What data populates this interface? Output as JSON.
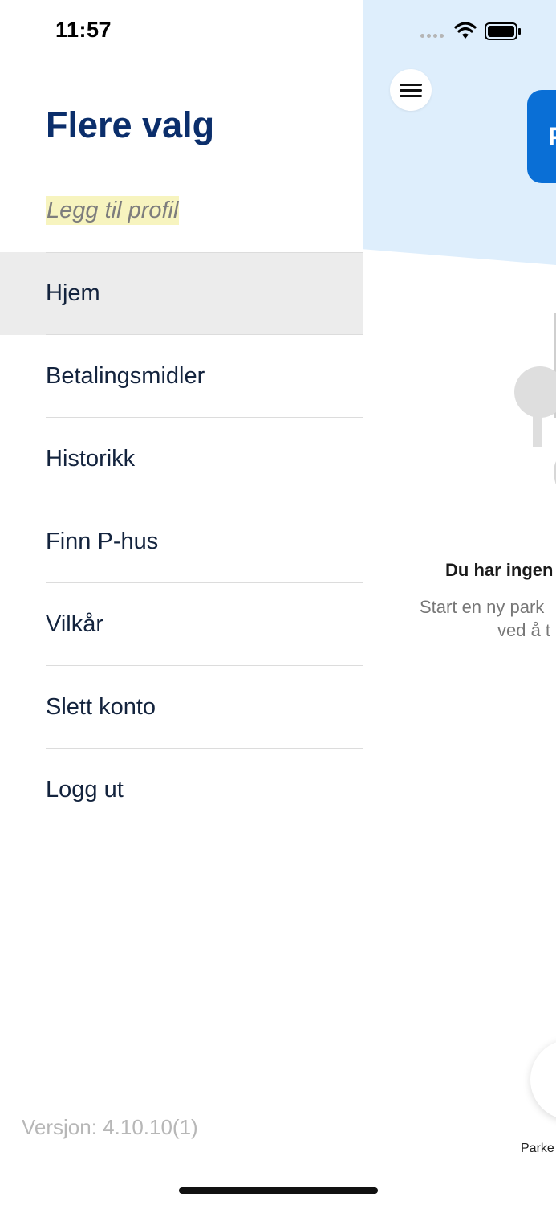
{
  "status_bar": {
    "time": "11:57",
    "icons": [
      "signal-icon",
      "wifi-icon",
      "battery-icon"
    ]
  },
  "drawer": {
    "title": "Flere valg",
    "add_profile": "Legg til profil",
    "menu_items": [
      {
        "label": "Hjem",
        "active": true
      },
      {
        "label": "Betalingsmidler",
        "active": false
      },
      {
        "label": "Historikk",
        "active": false
      },
      {
        "label": "Finn P-hus",
        "active": false
      },
      {
        "label": "Vilkår",
        "active": false
      },
      {
        "label": "Slett konto",
        "active": false
      },
      {
        "label": "Logg ut",
        "active": false
      }
    ],
    "version": "Versjon: 4.10.10(1)"
  },
  "main": {
    "menu_icon": "hamburger-icon",
    "card_text": "P",
    "empty_title": "Du har ingen",
    "empty_desc_line1": "Start en ny park",
    "empty_desc_line2": "ved å t",
    "fab_label": "Parke"
  },
  "colors": {
    "title": "#0b2e6b",
    "hero_background": "#deeefc",
    "accent": "#0a6fd6",
    "active_row": "#ececec",
    "profile_highlight": "#f7f4bf"
  }
}
